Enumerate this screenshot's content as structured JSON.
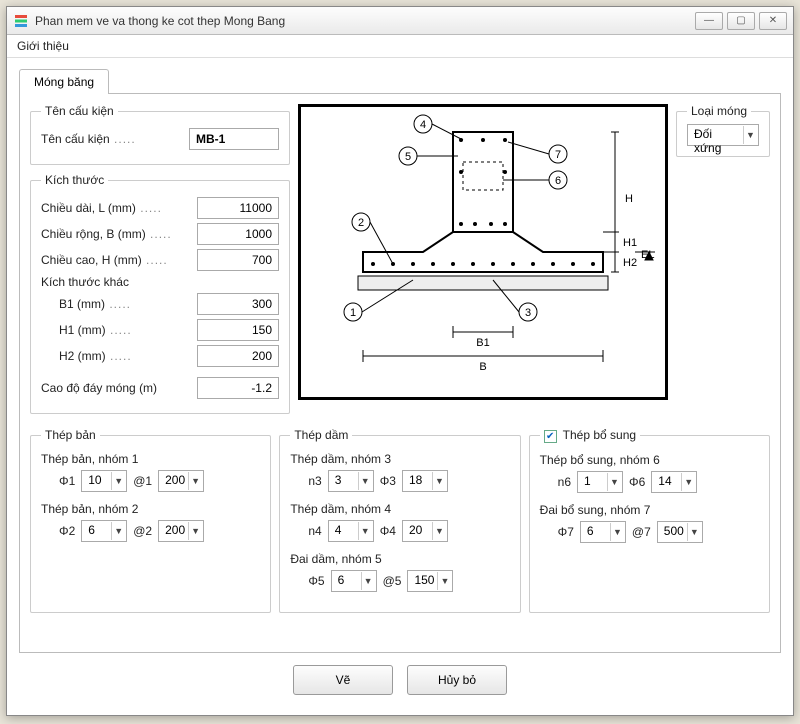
{
  "window": {
    "title": "Phan mem ve va thong ke cot thep Mong Bang"
  },
  "menu": {
    "about": "Giới thiệu"
  },
  "tab": {
    "label": "Móng băng"
  },
  "loai_mong": {
    "legend": "Loại móng",
    "value": "Đối xứng"
  },
  "ten_cau_kien": {
    "legend": "Tên cấu kiện",
    "label": "Tên cấu kiện",
    "value": "MB-1"
  },
  "kich_thuoc": {
    "legend": "Kích thước",
    "chieu_dai": {
      "label": "Chiều dài, L (mm)",
      "value": "11000"
    },
    "chieu_rong": {
      "label": "Chiều rộng, B (mm)",
      "value": "1000"
    },
    "chieu_cao": {
      "label": "Chiều cao, H (mm)",
      "value": "700"
    },
    "khac_title": "Kích thước khác",
    "b1": {
      "label": "B1 (mm)",
      "value": "300"
    },
    "h1": {
      "label": "H1 (mm)",
      "value": "150"
    },
    "h2": {
      "label": "H2 (mm)",
      "value": "200"
    },
    "cao_do": {
      "label": "Cao độ đáy móng (m)",
      "value": "-1.2"
    }
  },
  "thep_ban": {
    "legend": "Thép bản",
    "g1": {
      "title": "Thép bản, nhóm 1",
      "phi_lbl": "Φ1",
      "phi": "10",
      "at_lbl": "@1",
      "at": "200"
    },
    "g2": {
      "title": "Thép bản, nhóm 2",
      "phi_lbl": "Φ2",
      "phi": "6",
      "at_lbl": "@2",
      "at": "200"
    }
  },
  "thep_dam": {
    "legend": "Thép dầm",
    "g3": {
      "title": "Thép dầm, nhóm 3",
      "n_lbl": "n3",
      "n": "3",
      "phi_lbl": "Φ3",
      "phi": "18"
    },
    "g4": {
      "title": "Thép dầm, nhóm 4",
      "n_lbl": "n4",
      "n": "4",
      "phi_lbl": "Φ4",
      "phi": "20"
    },
    "g5": {
      "title": "Đai dầm, nhóm 5",
      "phi_lbl": "Φ5",
      "phi": "6",
      "at_lbl": "@5",
      "at": "150"
    }
  },
  "thep_bs": {
    "legend": "Thép bổ sung",
    "checked": true,
    "g6": {
      "title": "Thép bổ sung, nhóm 6",
      "n_lbl": "n6",
      "n": "1",
      "phi_lbl": "Φ6",
      "phi": "14"
    },
    "g7": {
      "title": "Đai bổ sung, nhóm 7",
      "phi_lbl": "Φ7",
      "phi": "6",
      "at_lbl": "@7",
      "at": "500"
    }
  },
  "diagram": {
    "callouts": {
      "c1": "1",
      "c2": "2",
      "c3": "3",
      "c4": "4",
      "c5": "5",
      "c6": "6",
      "c7": "7"
    },
    "dims": {
      "B": "B",
      "B1": "B1",
      "H": "H",
      "H1": "H1",
      "H2": "H2",
      "EL": "EL"
    }
  },
  "buttons": {
    "draw": "Vẽ",
    "cancel": "Hủy bỏ"
  }
}
